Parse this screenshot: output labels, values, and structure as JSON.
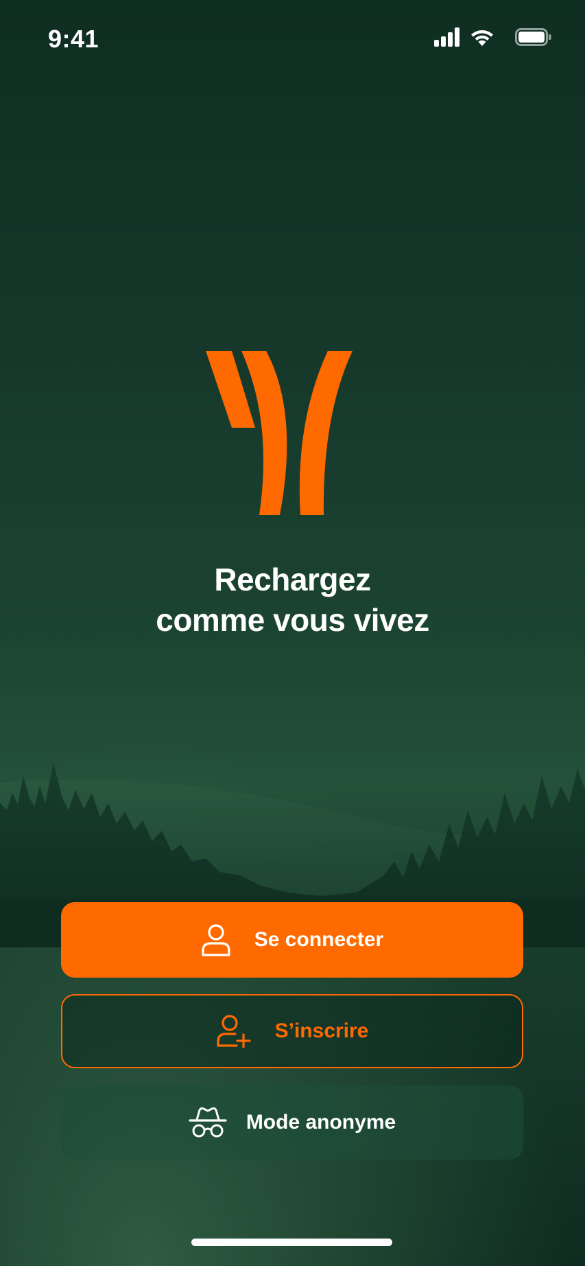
{
  "status_bar": {
    "time": "9:41",
    "icons": [
      "cellular-signal-icon",
      "wifi-icon",
      "battery-icon"
    ]
  },
  "brand": {
    "logo": "y-logo",
    "accent_color": "#ff6a00",
    "background_color": "#123426"
  },
  "tagline": {
    "line1": "Rechargez",
    "line2": "comme vous vivez"
  },
  "buttons": {
    "login": {
      "label": "Se connecter",
      "icon": "user-icon"
    },
    "signup": {
      "label": "S’inscrire",
      "icon": "user-plus-icon"
    },
    "anonymous": {
      "label": "Mode anonyme",
      "icon": "incognito-icon"
    }
  }
}
